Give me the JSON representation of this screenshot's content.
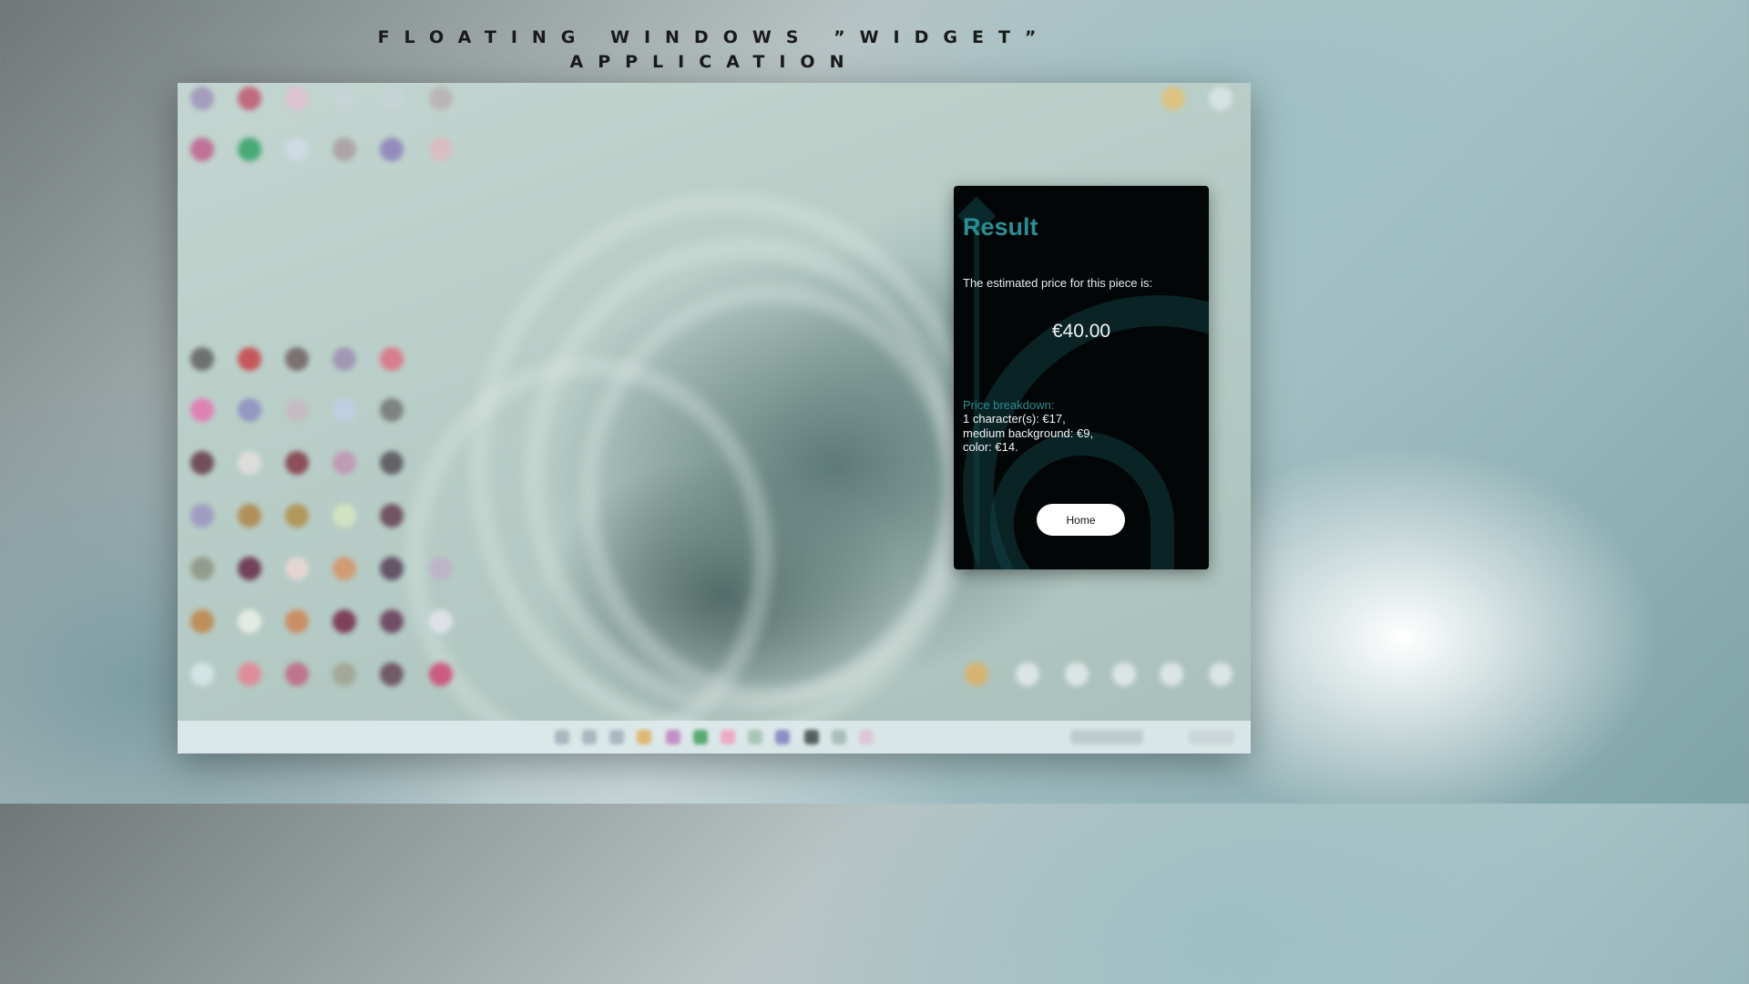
{
  "page_title": {
    "line1": "FLOATING WINDOWS ”WIDGET”",
    "line2": "APPLICATION"
  },
  "widget": {
    "title": "Result",
    "subtitle": "The estimated price for this piece is:",
    "price": "€40.00",
    "breakdown_label": "Price breakdown:",
    "breakdown_items": [
      "1 character(s): €17,",
      "medium background: €9,",
      "color: €14."
    ],
    "home_button": "Home",
    "accent_color": "#2a8d93",
    "background_color": "#020606"
  }
}
